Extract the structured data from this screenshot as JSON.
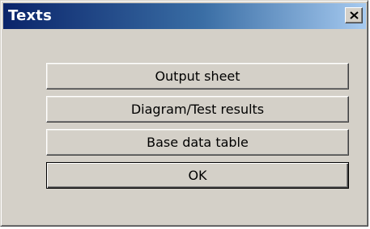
{
  "window": {
    "title": "Texts",
    "close_label": "✕"
  },
  "buttons": {
    "output_sheet": "Output sheet",
    "diagram_test_results": "Diagram/Test results",
    "base_data_table": "Base data table",
    "ok": "OK"
  },
  "colors": {
    "titlebar_start": "#0a246a",
    "titlebar_end": "#a6caf0",
    "face": "#d4d0c8"
  }
}
